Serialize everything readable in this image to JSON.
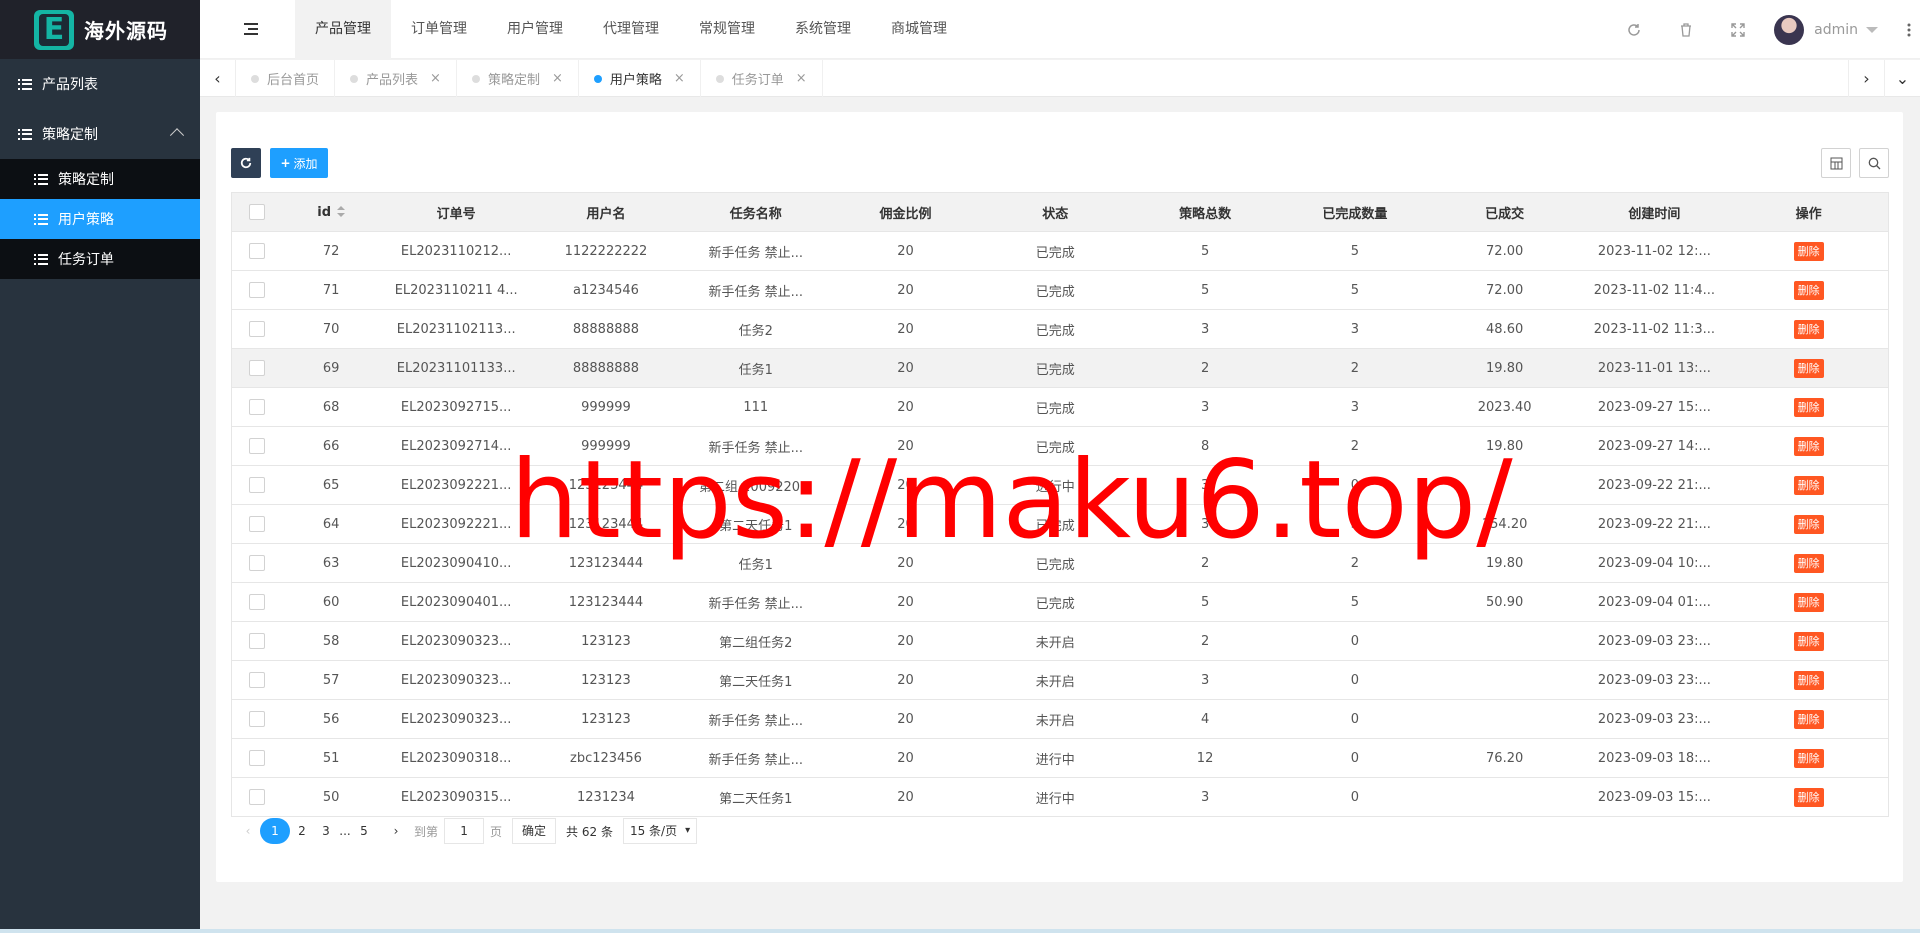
{
  "app": {
    "logo_letter": "E",
    "name": "海外源码"
  },
  "sidebar": {
    "items": [
      {
        "label": "产品列表"
      },
      {
        "label": "策略定制",
        "expanded": true
      }
    ],
    "sub_items": [
      {
        "label": "策略定制"
      },
      {
        "label": "用户策略",
        "active": true
      },
      {
        "label": "任务订单"
      }
    ]
  },
  "topnav": [
    "产品管理",
    "订单管理",
    "用户管理",
    "代理管理",
    "常规管理",
    "系统管理",
    "商城管理"
  ],
  "user": {
    "name": "admin"
  },
  "tabs": [
    {
      "label": "后台首页",
      "closable": false
    },
    {
      "label": "产品列表",
      "closable": true
    },
    {
      "label": "策略定制",
      "closable": true
    },
    {
      "label": "用户策略",
      "closable": true,
      "active": true
    },
    {
      "label": "任务订单",
      "closable": true
    }
  ],
  "toolbar": {
    "add_label": "添加"
  },
  "table": {
    "headers": [
      "id",
      "订单号",
      "用户名",
      "任务名称",
      "佣金比例",
      "状态",
      "策略总数",
      "已完成数量",
      "已成交",
      "创建时间",
      "操作"
    ],
    "delete_label": "删除",
    "rows": [
      [
        "72",
        "EL2023110212...",
        "1122222222",
        "新手任务 禁止...",
        "20",
        "已完成",
        "5",
        "5",
        "72.00",
        "2023-11-02 12:..."
      ],
      [
        "71",
        "EL2023110211 4...",
        "a1234546",
        "新手任务 禁止...",
        "20",
        "已完成",
        "5",
        "5",
        "72.00",
        "2023-11-02 11:4..."
      ],
      [
        "70",
        "EL20231102113...",
        "88888888",
        "任务2",
        "20",
        "已完成",
        "3",
        "3",
        "48.60",
        "2023-11-02 11:3..."
      ],
      [
        "69",
        "EL20231101133...",
        "88888888",
        "任务1",
        "20",
        "已完成",
        "2",
        "2",
        "19.80",
        "2023-11-01 13:..."
      ],
      [
        "68",
        "EL2023092715...",
        "999999",
        "111",
        "20",
        "已完成",
        "3",
        "3",
        "2023.40",
        "2023-09-27 15:..."
      ],
      [
        "66",
        "EL2023092714...",
        "999999",
        "新手任务 禁止...",
        "20",
        "已完成",
        "8",
        "2",
        "19.80",
        "2023-09-27 14:..."
      ],
      [
        "65",
        "EL2023092221...",
        "123123444",
        "第二组 2009220...",
        "20",
        "进行中",
        "3",
        "0",
        "",
        "2023-09-22 21:..."
      ],
      [
        "64",
        "EL2023092221...",
        "123123444",
        "第二天任务1",
        "20",
        "已完成",
        "3",
        "3",
        "154.20",
        "2023-09-22 21:..."
      ],
      [
        "63",
        "EL2023090410...",
        "123123444",
        "任务1",
        "20",
        "已完成",
        "2",
        "2",
        "19.80",
        "2023-09-04 10:..."
      ],
      [
        "60",
        "EL2023090401...",
        "123123444",
        "新手任务 禁止...",
        "20",
        "已完成",
        "5",
        "5",
        "50.90",
        "2023-09-04 01:..."
      ],
      [
        "58",
        "EL2023090323...",
        "123123",
        "第二组任务2",
        "20",
        "未开启",
        "2",
        "0",
        "",
        "2023-09-03 23:..."
      ],
      [
        "57",
        "EL2023090323...",
        "123123",
        "第二天任务1",
        "20",
        "未开启",
        "3",
        "0",
        "",
        "2023-09-03 23:..."
      ],
      [
        "56",
        "EL2023090323...",
        "123123",
        "新手任务 禁止...",
        "20",
        "未开启",
        "4",
        "0",
        "",
        "2023-09-03 23:..."
      ],
      [
        "51",
        "EL2023090318...",
        "zbc123456",
        "新手任务 禁止...",
        "20",
        "进行中",
        "12",
        "0",
        "76.20",
        "2023-09-03 18:..."
      ],
      [
        "50",
        "EL2023090315...",
        "1231234",
        "第二天任务1",
        "20",
        "进行中",
        "3",
        "0",
        "",
        "2023-09-03 15:..."
      ]
    ]
  },
  "pager": {
    "pages": [
      "1",
      "2",
      "3",
      "...",
      "5"
    ],
    "goto_label": "到第",
    "goto_value": "1",
    "page_unit": "页",
    "confirm": "确定",
    "total": "共 62 条",
    "limit": "15 条/页"
  },
  "watermark": "https://maku6.top/",
  "colors": {
    "accent": "#1e9fff",
    "sidebar": "#28333e",
    "danger": "#ff5722",
    "dark_button": "#2f4056"
  }
}
